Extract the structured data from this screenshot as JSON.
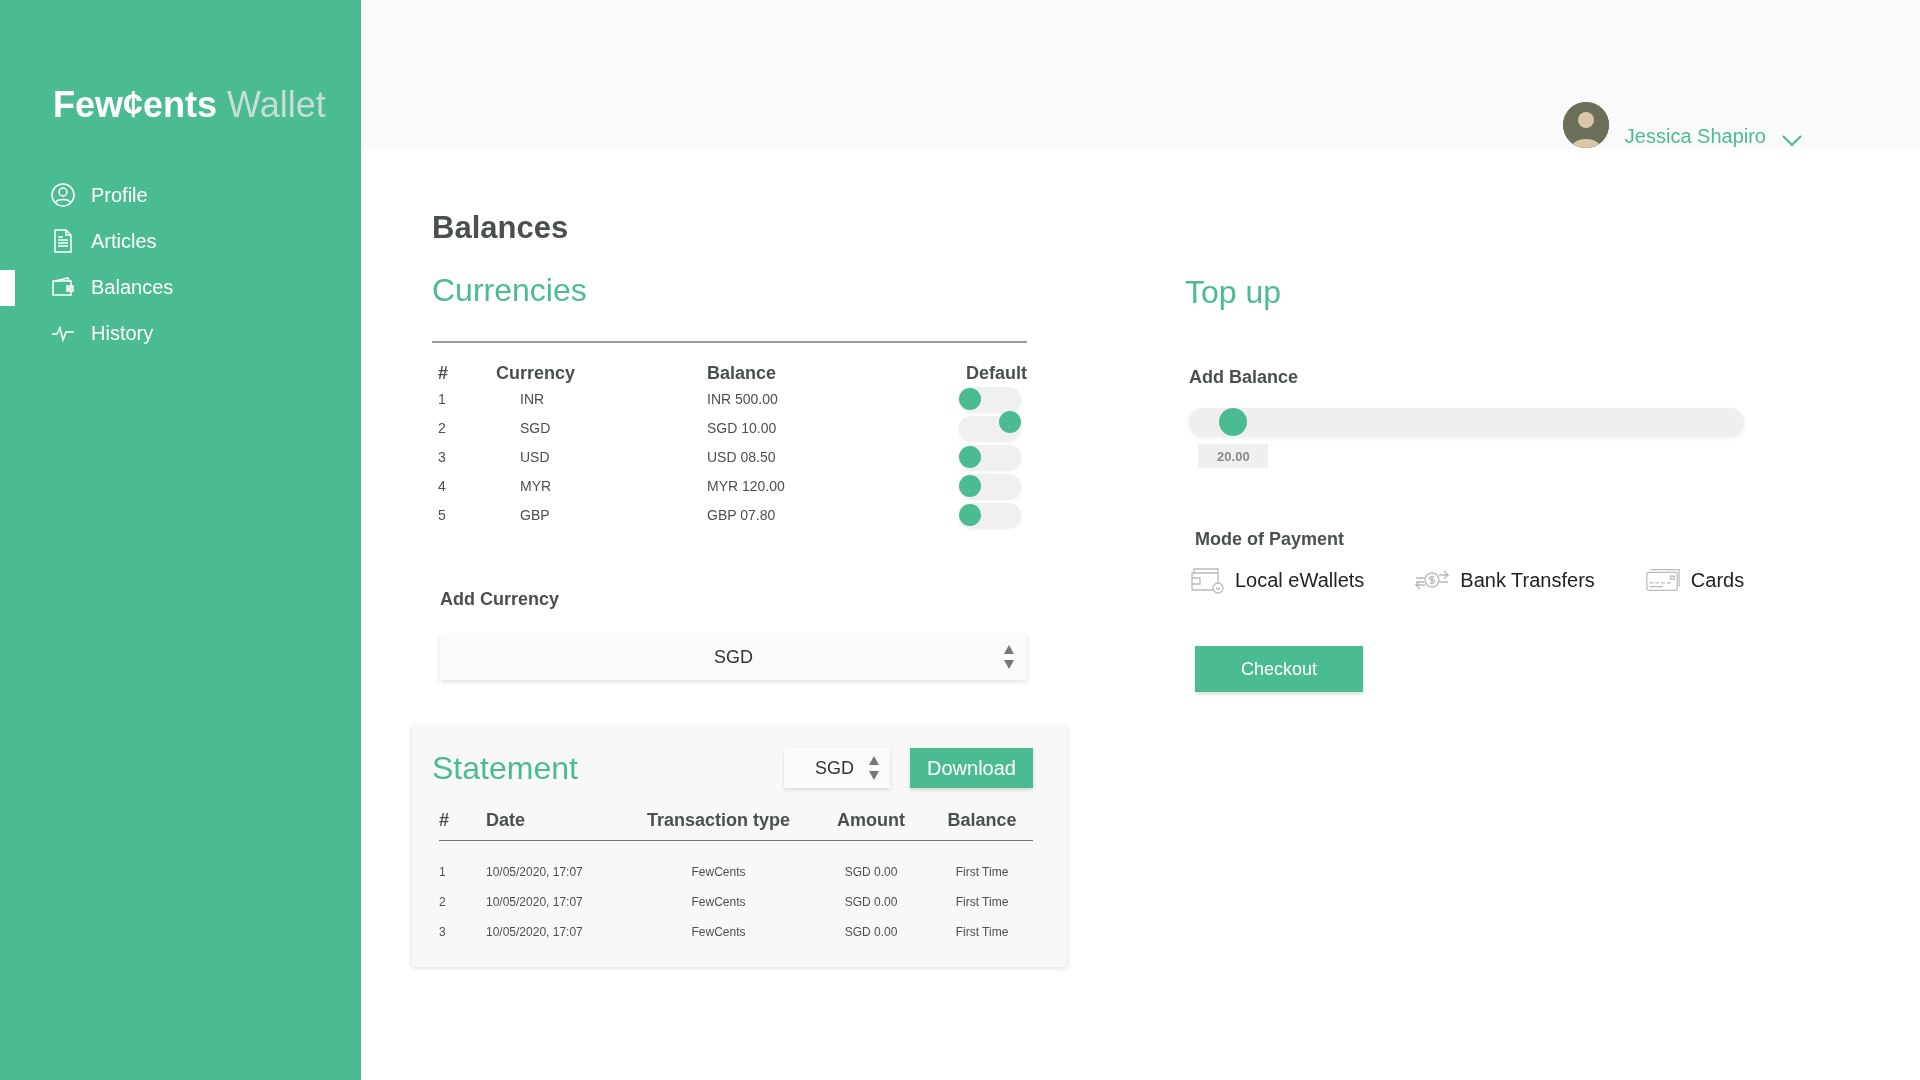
{
  "sidebar": {
    "logo": {
      "brand": "Few¢ents",
      "product": "Wallet"
    },
    "items": [
      {
        "label": "Profile",
        "kind": "profile",
        "selected": false
      },
      {
        "label": "Articles",
        "kind": "articles",
        "selected": false
      },
      {
        "label": "Balances",
        "kind": "wallet",
        "selected": true
      },
      {
        "label": "History",
        "kind": "history",
        "selected": false
      }
    ]
  },
  "header": {
    "user": {
      "name": "Jessica Shapiro"
    }
  },
  "page_title": "Balances",
  "currencies": {
    "title": "Currencies",
    "columns": [
      "#",
      "Currency",
      "Balance",
      "Default"
    ],
    "rows": [
      {
        "index": "1",
        "currency": "INR",
        "balance": "INR 500.00",
        "default": false
      },
      {
        "index": "2",
        "currency": "SGD",
        "balance": "SGD 10.00",
        "default": true
      },
      {
        "index": "3",
        "currency": "USD",
        "balance": "USD 08.50",
        "default": false
      },
      {
        "index": "4",
        "currency": "MYR",
        "balance": "MYR 120.00",
        "default": false
      },
      {
        "index": "5",
        "currency": "GBP",
        "balance": "GBP 07.80",
        "default": false
      }
    ],
    "add_currency": {
      "label": "Add Currency",
      "value": "SGD"
    }
  },
  "statement": {
    "title": "Statement",
    "currency": "SGD",
    "download": "Download",
    "columns": [
      "#",
      "Date",
      "Transaction type",
      "Amount",
      "Balance"
    ],
    "rows": [
      {
        "index": "1",
        "date": "10/05/2020, 17:07",
        "type": "FewCents",
        "amount": "SGD 0.00",
        "balance": "First Time"
      },
      {
        "index": "2",
        "date": "10/05/2020, 17:07",
        "type": "FewCents",
        "amount": "SGD 0.00",
        "balance": "First Time"
      },
      {
        "index": "3",
        "date": "10/05/2020, 17:07",
        "type": "FewCents",
        "amount": "SGD 0.00",
        "balance": "First Time"
      }
    ]
  },
  "top_up": {
    "title": "Top up",
    "add_balance": {
      "label": "Add Balance",
      "level": 0.08,
      "value": "20.00"
    },
    "payment": {
      "label": "Mode of Payment",
      "options": [
        {
          "label": "Local eWallets",
          "kind": "ewallet"
        },
        {
          "label": "Bank Transfers",
          "kind": "bank"
        },
        {
          "label": "Cards",
          "kind": "card"
        }
      ]
    },
    "checkout": "Checkout"
  }
}
